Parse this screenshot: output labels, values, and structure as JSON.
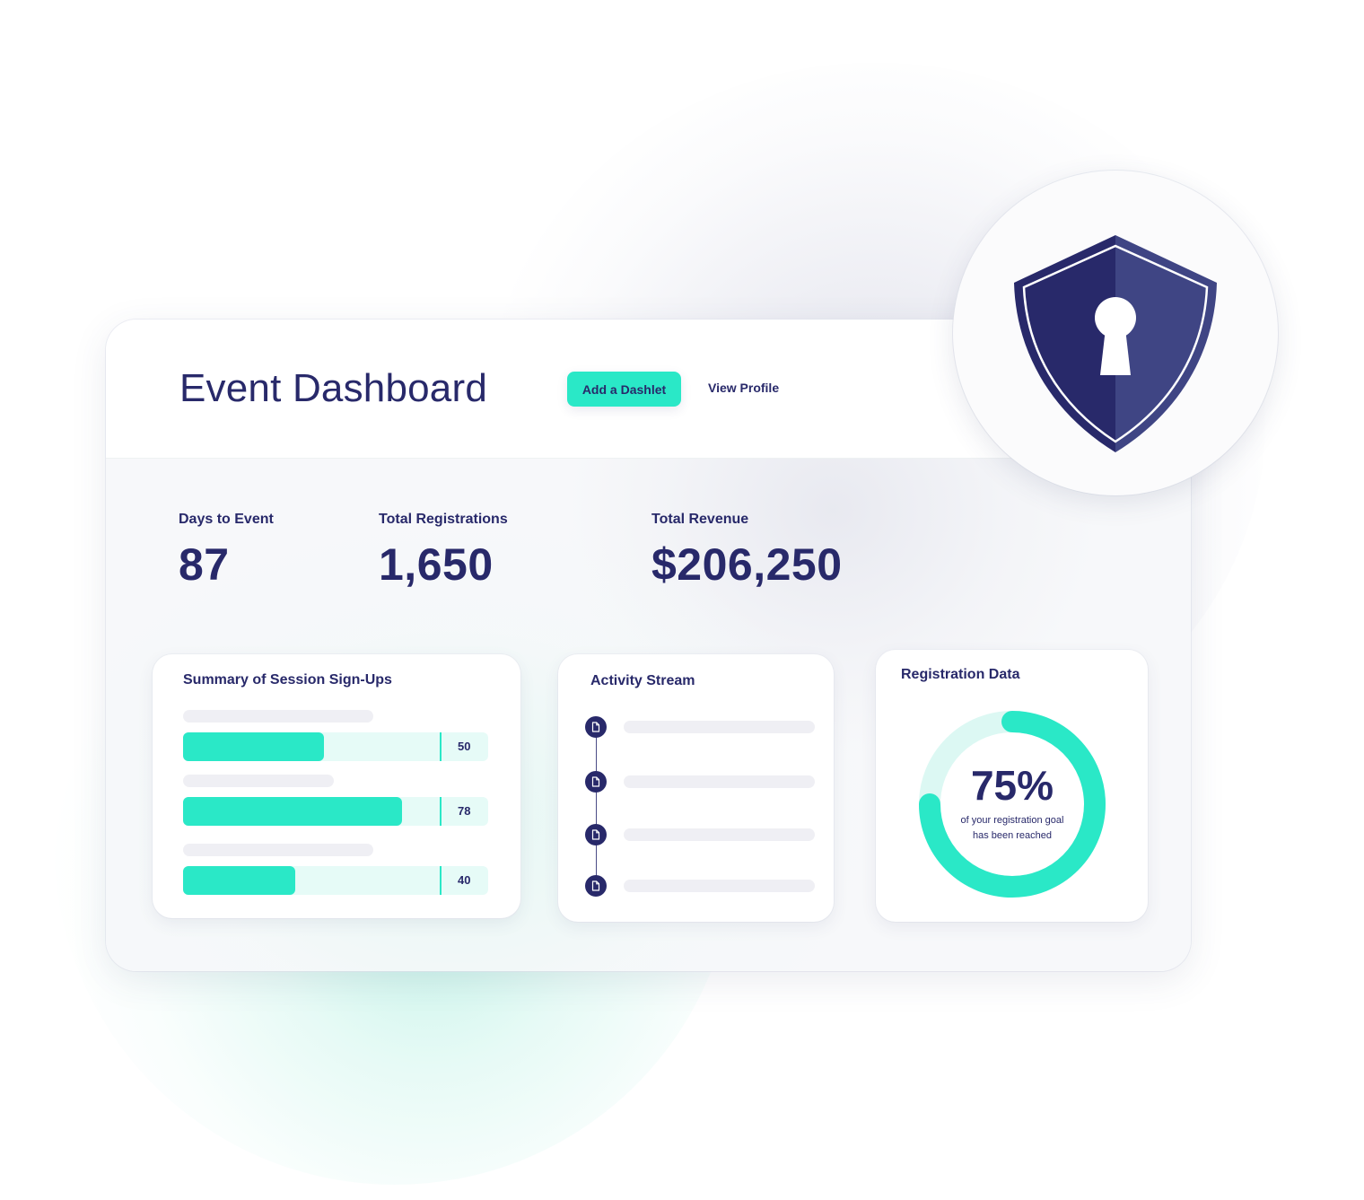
{
  "header": {
    "title": "Event Dashboard",
    "add_dashlet_label": "Add a Dashlet",
    "view_profile_label": "View Profile"
  },
  "metrics": [
    {
      "label": "Days to Event",
      "value": "87"
    },
    {
      "label": "Total Registrations",
      "value": "1,650"
    },
    {
      "label": "Total Revenue",
      "value": "$206,250"
    }
  ],
  "signups": {
    "title": "Summary of Session Sign-Ups",
    "max": 100,
    "rows": [
      {
        "value": 50,
        "label": "50"
      },
      {
        "value": 78,
        "label": "78"
      },
      {
        "value": 40,
        "label": "40"
      }
    ]
  },
  "activity": {
    "title": "Activity Stream",
    "items": [
      {
        "icon": "document-icon"
      },
      {
        "icon": "document-icon"
      },
      {
        "icon": "document-icon"
      },
      {
        "icon": "document-icon"
      }
    ]
  },
  "registration": {
    "title": "Registration Data",
    "percent": 75,
    "percent_label": "75%",
    "caption_line1": "of your registration goal",
    "caption_line2": "has been reached"
  },
  "badge": {
    "icon": "shield-keyhole-icon"
  },
  "colors": {
    "accent": "#2ae8c7",
    "accent_light": "#e6fbf7",
    "navy": "#28296a",
    "navy_light": "#3f4584",
    "placeholder": "#efeff4"
  }
}
